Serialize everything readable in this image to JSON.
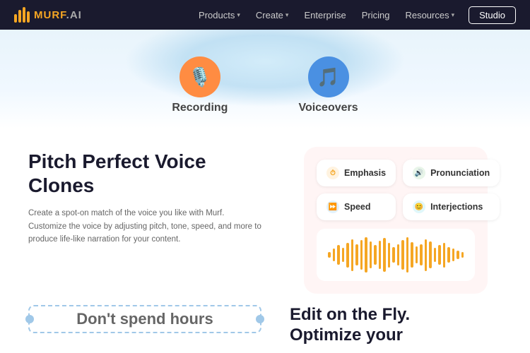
{
  "navbar": {
    "logo_text": "MURF",
    "logo_suffix": ".AI",
    "nav_items": [
      {
        "label": "Products",
        "has_chevron": true
      },
      {
        "label": "Create",
        "has_chevron": true
      },
      {
        "label": "Enterprise",
        "has_chevron": false
      },
      {
        "label": "Pricing",
        "has_chevron": false
      },
      {
        "label": "Resources",
        "has_chevron": true
      }
    ],
    "studio_btn": "Studio"
  },
  "hero": {
    "recording_label": "Recording",
    "voiceover_label": "Voiceovers"
  },
  "pitch_section": {
    "title_line1": "Pitch Perfect Voice",
    "title_line2": "Clones",
    "description": "Create a spot-on match of the voice you like with Murf. Customize the voice by adjusting pitch, tone, speed, and more to produce life-like narration for your content."
  },
  "voice_card": {
    "features": [
      {
        "label": "Emphasis",
        "icon": "clock",
        "icon_class": "feat-orange"
      },
      {
        "label": "Pronunciation",
        "icon": "sound",
        "icon_class": "feat-green"
      },
      {
        "label": "Speed",
        "icon": "fast-forward",
        "icon_class": "feat-blue"
      },
      {
        "label": "Interjections",
        "icon": "smile",
        "icon_class": "feat-teal"
      }
    ],
    "waveform_bars": [
      8,
      18,
      28,
      20,
      35,
      45,
      30,
      42,
      50,
      38,
      28,
      40,
      48,
      35,
      22,
      30,
      42,
      50,
      36,
      24,
      30,
      45,
      38,
      20,
      28,
      35,
      22,
      18,
      12,
      8
    ]
  },
  "bottom": {
    "dont_spend_label": "Don't spend hours",
    "edit_title_line1": "Edit on the Fly.",
    "edit_title_line2": "Optimize your"
  }
}
